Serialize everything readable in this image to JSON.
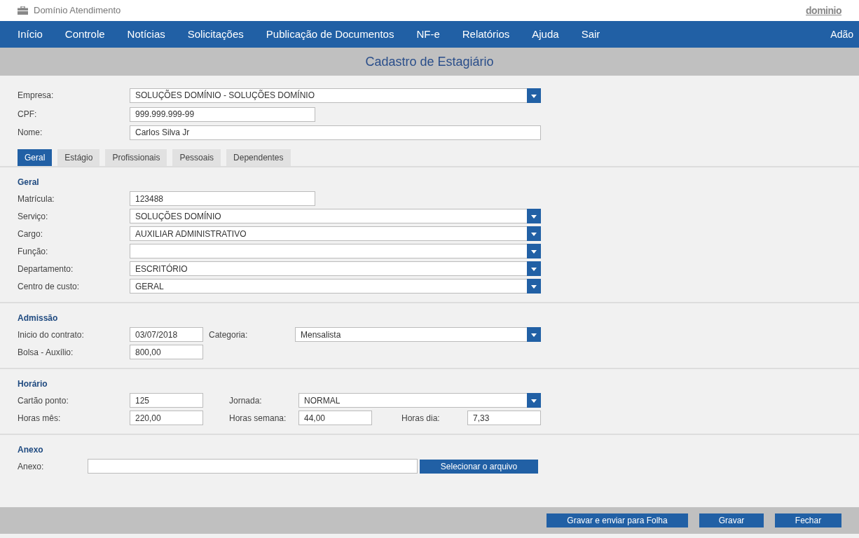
{
  "app": {
    "title": "Domínio Atendimento",
    "logo": "dominio"
  },
  "nav": {
    "items": [
      "Início",
      "Controle",
      "Notícias",
      "Solicitações",
      "Publicação de Documentos",
      "NF-e",
      "Relatórios",
      "Ajuda",
      "Sair"
    ],
    "user": "Adão"
  },
  "page_title": "Cadastro de Estagiário",
  "header_fields": [
    {
      "label": "Empresa:",
      "kind": "select",
      "value": "SOLUÇÕES DOMÍNIO - SOLUÇÕES DOMÍNIO"
    },
    {
      "label": "CPF:",
      "kind": "text",
      "value": "999.999.999-99"
    },
    {
      "label": "Nome:",
      "kind": "text",
      "value": "Carlos Silva Jr"
    }
  ],
  "tabs": [
    {
      "label": "Geral",
      "selected": true
    },
    {
      "label": "Estágio",
      "selected": false
    },
    {
      "label": "Profissionais",
      "selected": false
    },
    {
      "label": "Pessoais",
      "selected": false
    },
    {
      "label": "Dependentes",
      "selected": false
    }
  ],
  "sections": [
    {
      "title": "Geral",
      "fields": [
        {
          "label": "Matrícula:",
          "kind": "text",
          "value": "123488"
        },
        {
          "label": "Serviço:",
          "kind": "select",
          "value": "SOLUÇÕES DOMÍNIO"
        },
        {
          "label": "Cargo:",
          "kind": "select",
          "value": "AUXILIAR ADMINISTRATIVO"
        },
        {
          "label": "Função:",
          "kind": "select"
        },
        {
          "label": "Departamento:",
          "kind": "select",
          "value": "ESCRITÓRIO"
        },
        {
          "label": "Centro de custo:",
          "kind": "select",
          "value": "GERAL"
        }
      ]
    },
    {
      "title": "Admissão",
      "fields": [
        {
          "label": "Inicio do contrato:",
          "kind": "text",
          "value": "03/07/2018"
        },
        {
          "label": "Categoria:",
          "kind": "select",
          "value": "Mensalista"
        },
        {
          "label": "Bolsa - Auxílio:",
          "kind": "text",
          "value": "800,00"
        }
      ]
    },
    {
      "title": "Horário",
      "fields": [
        {
          "label": "Cartão ponto:",
          "kind": "text",
          "value": "125"
        },
        {
          "label": "Jornada:",
          "kind": "select",
          "value": "NORMAL"
        },
        {
          "label": "Horas mês:",
          "kind": "text",
          "value": "220,00"
        },
        {
          "label": "Horas semana:",
          "kind": "text",
          "value": "44,00"
        },
        {
          "label": "Horas dia:",
          "kind": "text",
          "value": "7,33"
        }
      ]
    },
    {
      "title": "Anexo",
      "fields": [
        {
          "label": "Anexo:",
          "kind": "file",
          "button": "Selecionar o arquivo"
        }
      ]
    }
  ],
  "footer_buttons": [
    "Gravar e enviar para Folha",
    "Gravar",
    "Fechar"
  ]
}
